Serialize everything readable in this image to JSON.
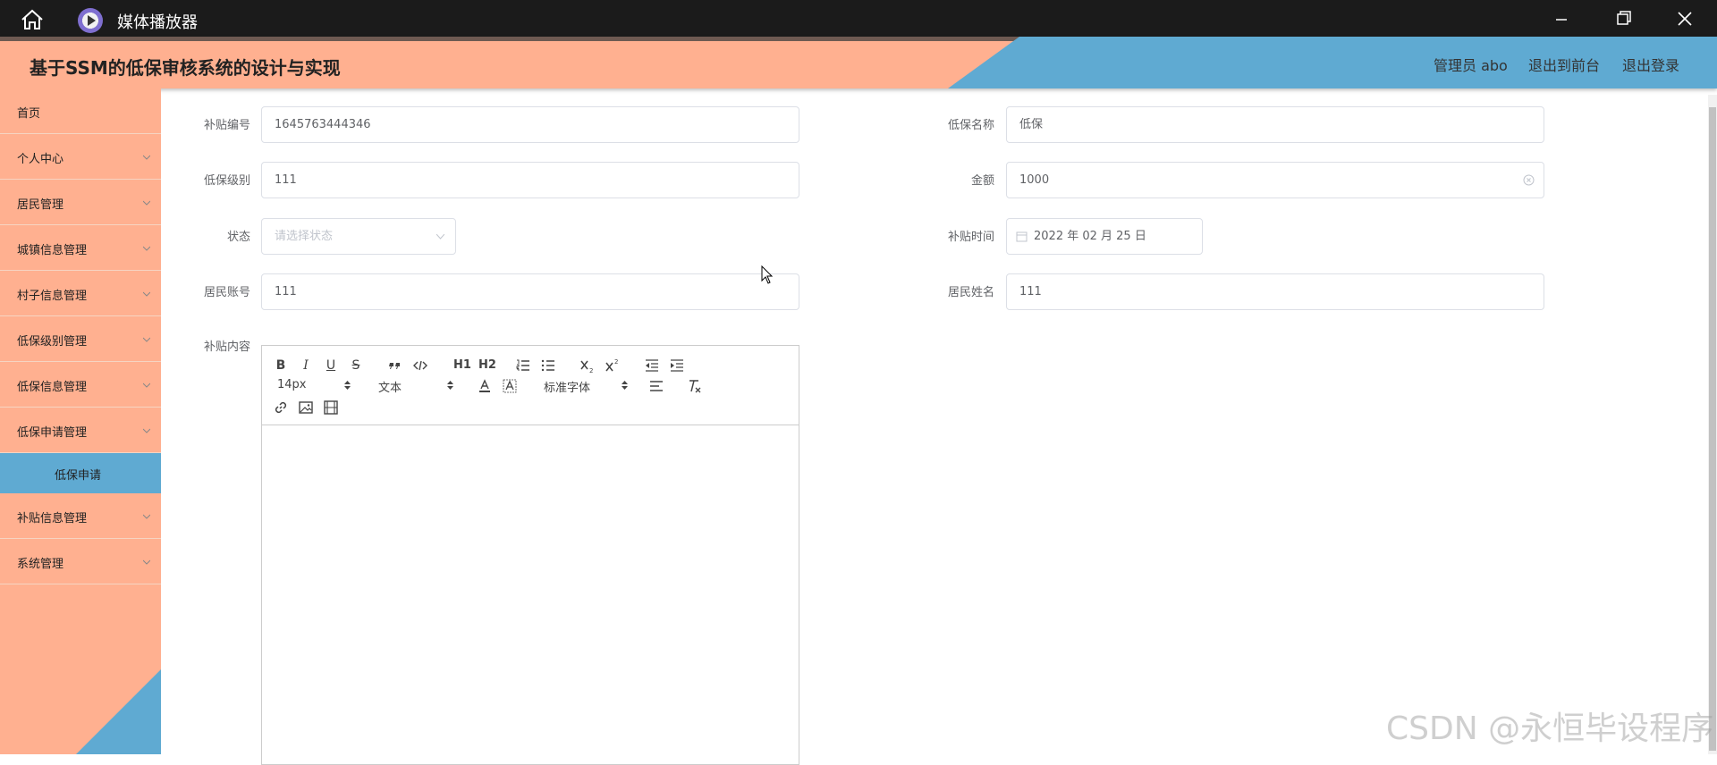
{
  "window": {
    "app_title": "媒体播放器",
    "icons": [
      "home-icon",
      "media-player-icon",
      "minimize-icon",
      "maximize-icon",
      "close-icon"
    ]
  },
  "header": {
    "title": "基于SSM的低保审核系统的设计与实现",
    "user": "管理员 abo",
    "front_link": "退出到前台",
    "logout_link": "退出登录",
    "colors": {
      "peach": "#ffb090",
      "blue": "#5faad2"
    }
  },
  "sidebar": {
    "items": [
      {
        "label": "首页"
      },
      {
        "label": "个人中心"
      },
      {
        "label": "居民管理"
      },
      {
        "label": "城镇信息管理"
      },
      {
        "label": "村子信息管理"
      },
      {
        "label": "低保级别管理"
      },
      {
        "label": "低保信息管理"
      },
      {
        "label": "低保申请管理"
      },
      {
        "label": "低保申请"
      },
      {
        "label": "补贴信息管理"
      },
      {
        "label": "系统管理"
      }
    ]
  },
  "form": {
    "subsidy_no": {
      "label": "补贴编号",
      "value": "1645763444346"
    },
    "dibao_name": {
      "label": "低保名称",
      "value": "低保"
    },
    "dibao_level": {
      "label": "低保级别",
      "value": "111"
    },
    "amount": {
      "label": "金额",
      "value": "1000"
    },
    "status": {
      "label": "状态",
      "placeholder": "请选择状态"
    },
    "subsidy_time": {
      "label": "补贴时间",
      "value": "2022 年 02 月 25 日"
    },
    "resident_account": {
      "label": "居民账号",
      "value": "111"
    },
    "resident_name": {
      "label": "居民姓名",
      "value": "111"
    },
    "content": {
      "label": "补贴内容"
    }
  },
  "editor": {
    "font_size": "14px",
    "block_type": "文本",
    "font_family": "标准字体",
    "buttons": {
      "bold": "B",
      "italic": "I",
      "underline": "U",
      "strike": "S",
      "h1": "H1",
      "h2": "H2"
    }
  },
  "watermark": "CSDN @永恒毕设程序"
}
